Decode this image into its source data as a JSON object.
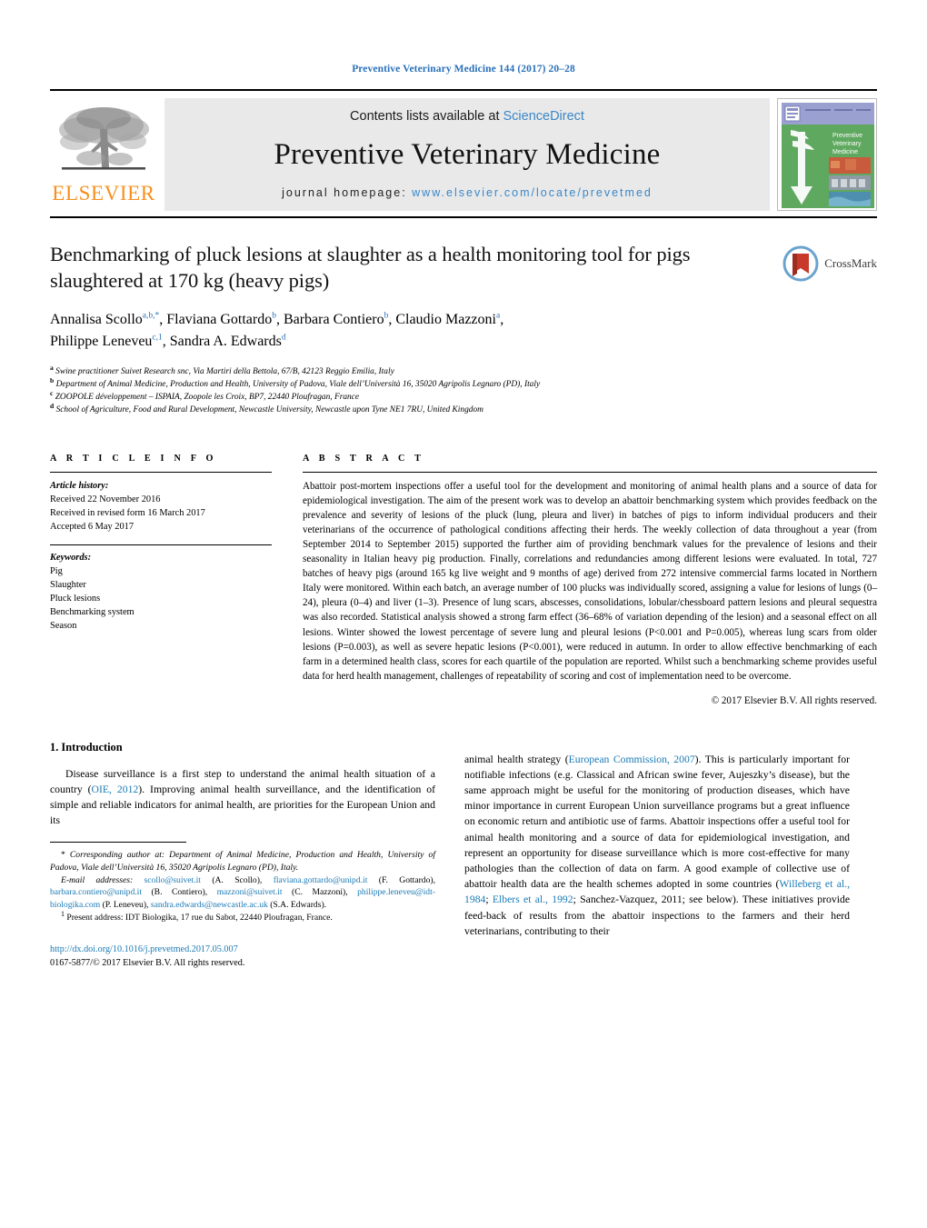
{
  "running_head": "Preventive Veterinary Medicine 144 (2017) 20–28",
  "masthead": {
    "contents_prefix": "Contents lists available at ",
    "sciencedirect": "ScienceDirect",
    "journal_title": "Preventive Veterinary Medicine",
    "homepage_prefix": "journal homepage: ",
    "homepage_url": "www.elsevier.com/locate/prevetmed",
    "publisher_wordmark": "ELSEVIER",
    "cover_title_lines": [
      "Preventive",
      "Veterinary",
      "Medicine"
    ],
    "brand_orange": "#f7901e",
    "link_blue": "#3a87c8"
  },
  "article": {
    "title": "Benchmarking of pluck lesions at slaughter as a health monitoring tool for pigs slaughtered at 170 kg (heavy pigs)",
    "crossmark_label": "CrossMark",
    "authors": [
      {
        "name": "Annalisa Scollo",
        "marks": "a,b,*"
      },
      {
        "name": "Flaviana Gottardo",
        "marks": "b"
      },
      {
        "name": "Barbara Contiero",
        "marks": "b"
      },
      {
        "name": "Claudio Mazzoni",
        "marks": "a"
      },
      {
        "name": "Philippe Leneveu",
        "marks": "c,1"
      },
      {
        "name": "Sandra A. Edwards",
        "marks": "d"
      }
    ],
    "affiliations": [
      {
        "mark": "a",
        "text": "Swine practitioner Suivet Research snc, Via Martiri della Bettola, 67/B, 42123 Reggio Emilia, Italy"
      },
      {
        "mark": "b",
        "text": "Department of Animal Medicine, Production and Health, University of Padova, Viale dell’Università 16, 35020 Agripolis Legnaro (PD), Italy"
      },
      {
        "mark": "c",
        "text": "ZOOPOLE développement – ISPAIA, Zoopole les Croix, BP7, 22440 Ploufragan, France"
      },
      {
        "mark": "d",
        "text": "School of Agriculture, Food and Rural Development, Newcastle University, Newcastle upon Tyne NE1 7RU, United Kingdom"
      }
    ]
  },
  "article_info": {
    "heading": "A R T I C L E    I N F O",
    "history_label": "Article history:",
    "history": [
      "Received 22 November 2016",
      "Received in revised form 16 March 2017",
      "Accepted 6 May 2017"
    ],
    "keywords_label": "Keywords:",
    "keywords": [
      "Pig",
      "Slaughter",
      "Pluck lesions",
      "Benchmarking system",
      "Season"
    ]
  },
  "abstract": {
    "heading": "A B S T R A C T",
    "text": "Abattoir post-mortem inspections offer a useful tool for the development and monitoring of animal health plans and a source of data for epidemiological investigation. The aim of the present work was to develop an abattoir benchmarking system which provides feedback on the prevalence and severity of lesions of the pluck (lung, pleura and liver) in batches of pigs to inform individual producers and their veterinarians of the occurrence of pathological conditions affecting their herds. The weekly collection of data throughout a year (from September 2014 to September 2015) supported the further aim of providing benchmark values for the prevalence of lesions and their seasonality in Italian heavy pig production. Finally, correlations and redundancies among different lesions were evaluated. In total, 727 batches of heavy pigs (around 165 kg live weight and 9 months of age) derived from 272 intensive commercial farms located in Northern Italy were monitored. Within each batch, an average number of 100 plucks was individually scored, assigning a value for lesions of lungs (0–24), pleura (0–4) and liver (1–3). Presence of lung scars, abscesses, consolidations, lobular/chessboard pattern lesions and pleural sequestra was also recorded. Statistical analysis showed a strong farm effect (36–68% of variation depending of the lesion) and a seasonal effect on all lesions. Winter showed the lowest percentage of severe lung and pleural lesions (P<0.001 and P=0.005), whereas lung scars from older lesions (P=0.003), as well as severe hepatic lesions (P<0.001), were reduced in autumn. In order to allow effective benchmarking of each farm in a determined health class, scores for each quartile of the population are reported. Whilst such a benchmarking scheme provides useful data for herd health management, challenges of repeatability of scoring and cost of implementation need to be overcome.",
    "copyright": "© 2017 Elsevier B.V. All rights reserved."
  },
  "introduction": {
    "number_and_title": "1.  Introduction",
    "left_para_part1": "Disease surveillance is a first step to understand the animal health situation of a country (",
    "left_link1": "OIE, 2012",
    "left_para_part2": "). Improving animal health surveillance, and the identification of simple and reliable indicators for animal health, are priorities for the European Union and its",
    "right_para_part1": "animal health strategy (",
    "right_link1": "European Commission, 2007",
    "right_para_part2": "). This is particularly important for notifiable infections (e.g. Classical and African swine fever, Aujeszky’s disease), but the same approach might be useful for the monitoring of production diseases, which have minor importance in current European Union surveillance programs but a great influence on economic return and antibiotic use of farms. Abattoir inspections offer a useful tool for animal health monitoring and a source of data for epidemiological investigation, and represent an opportunity for disease surveillance which is more cost-effective for many pathologies than the collection of data on farm. A good example of collective use of abattoir health data are the health schemes adopted in some countries (",
    "right_link2": "Willeberg et al., 1984",
    "right_sep1": "; ",
    "right_link3": "Elbers et al., 1992",
    "right_para_part3": "; Sanchez-Vazquez, 2011; see below). These initiatives provide feed-back of results from the abattoir inspections to the farmers and their herd veterinarians, contributing to their"
  },
  "footnotes": {
    "corresponding_marker": "*",
    "corresponding": "Corresponding author at: Department of Animal Medicine, Production and Health, University of Padova, Viale dell’Università 16, 35020 Agripolis Legnaro (PD), Italy.",
    "email_label": "E-mail addresses:",
    "emails": [
      {
        "address": "scollo@suivet.it",
        "owner": "(A. Scollo),"
      },
      {
        "address": "flaviana.gottardo@unipd.it",
        "owner": "(F. Gottardo),"
      },
      {
        "address": "barbara.contiero@unipd.it",
        "owner": "(B. Contiero),"
      },
      {
        "address": "mazzoni@suivet.it",
        "owner": "(C. Mazzoni),"
      },
      {
        "address": "philippe.leneveu@idt-biologika.com",
        "owner": "(P. Leneveu),"
      },
      {
        "address": "sandra.edwards@newcastle.ac.uk",
        "owner": "(S.A. Edwards)."
      }
    ],
    "present_address_marker": "1",
    "present_address": "Present address: IDT Biologika, 17 rue du Sabot, 22440 Ploufragan, France.",
    "doi": "http://dx.doi.org/10.1016/j.prevetmed.2017.05.007",
    "issn_line": "0167-5877/© 2017 Elsevier B.V. All rights reserved."
  }
}
